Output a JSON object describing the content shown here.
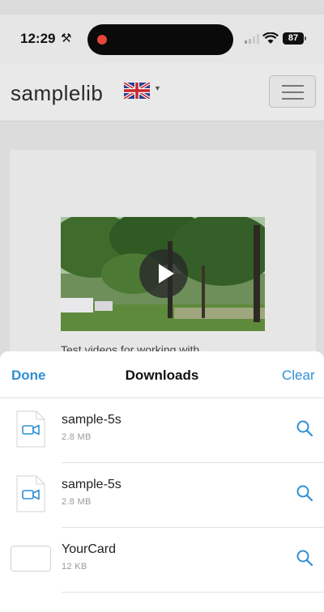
{
  "status_bar": {
    "time": "12:29",
    "battery": "87"
  },
  "site": {
    "logo": "samplelib"
  },
  "content": {
    "peek_text": "Test videos for working with"
  },
  "downloads": {
    "done_label": "Done",
    "title": "Downloads",
    "clear_label": "Clear",
    "items": [
      {
        "name": "sample-5s",
        "size": "2.8 MB",
        "icon": "video-file-icon"
      },
      {
        "name": "sample-5s",
        "size": "2.8 MB",
        "icon": "video-file-icon"
      },
      {
        "name": "YourCard",
        "size": "12 KB",
        "icon": "blank-file-icon"
      }
    ]
  },
  "colors": {
    "accent": "#2f8fd4",
    "recording_dot": "#e8453c"
  }
}
